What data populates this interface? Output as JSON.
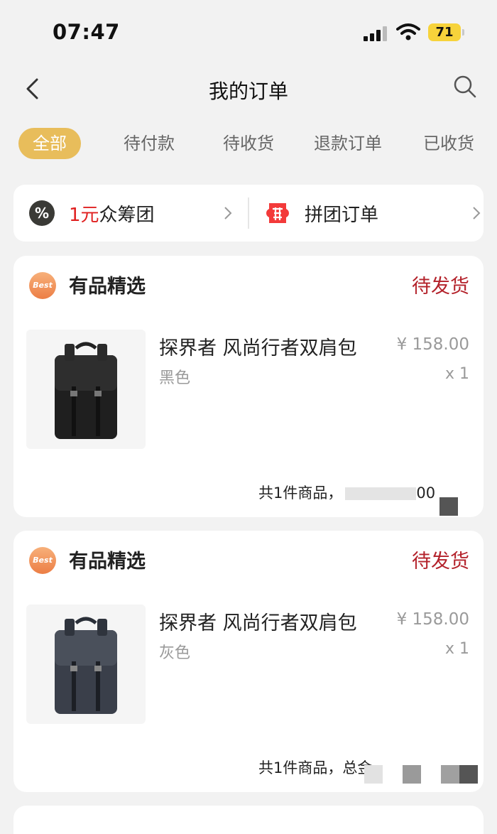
{
  "status_bar": {
    "time": "07:47",
    "battery": "71"
  },
  "nav": {
    "title": "我的订单"
  },
  "tabs": [
    {
      "label": "全部",
      "active": true
    },
    {
      "label": "待付款"
    },
    {
      "label": "待收货"
    },
    {
      "label": "退款订单"
    },
    {
      "label": "已收货"
    }
  ],
  "promo": {
    "left": {
      "icon_text": "%",
      "highlight": "1元",
      "label": "众筹团"
    },
    "right": {
      "label": "拼团订单"
    }
  },
  "orders": [
    {
      "shop": "有品精选",
      "badge": "Best",
      "status": "待发货",
      "product": "探界者 风尚行者双肩包",
      "variant": "黑色",
      "price": "¥ 158.00",
      "qty": "x 1",
      "summary": "共1件商品，",
      "summary_tail": "00"
    },
    {
      "shop": "有品精选",
      "badge": "Best",
      "status": "待发货",
      "product": "探界者 风尚行者双肩包",
      "variant": "灰色",
      "price": "¥ 158.00",
      "qty": "x 1",
      "summary": "共1件商品，总金"
    }
  ],
  "colors": {
    "accent": "#e8bd5b",
    "status_red": "#b3212a",
    "promo_red": "#e02020"
  },
  "icons": [
    "back-icon",
    "search-icon",
    "signal-icon",
    "wifi-icon",
    "crowdfund-icon",
    "group-buy-icon",
    "chevron-right-icon",
    "best-badge-icon"
  ]
}
